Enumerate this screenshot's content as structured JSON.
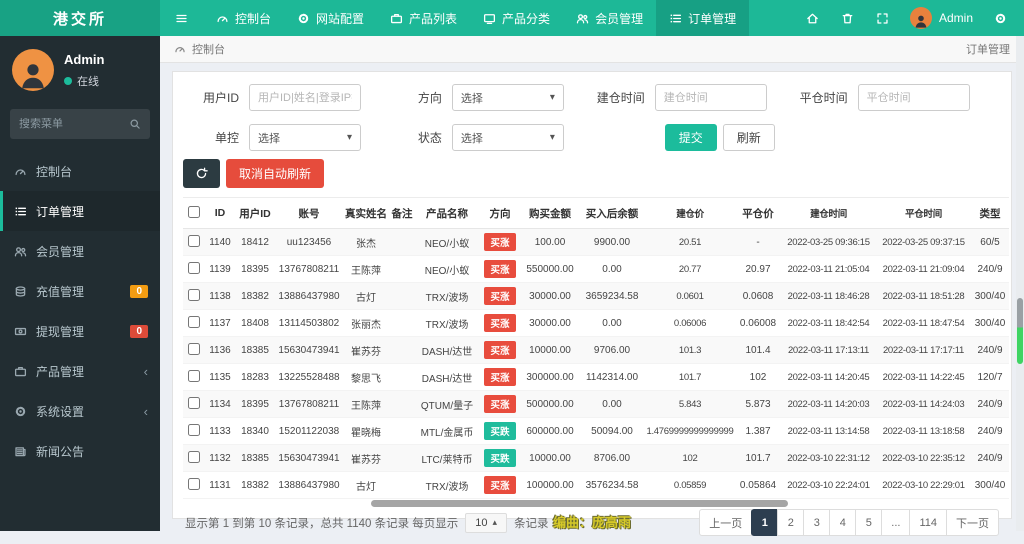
{
  "navbar": {
    "brand": "港交所",
    "items": [
      {
        "label": "控制台",
        "icon": "dashboard-icon"
      },
      {
        "label": "网站配置",
        "icon": "gear-icon"
      },
      {
        "label": "产品列表",
        "icon": "briefcase-icon"
      },
      {
        "label": "产品分类",
        "icon": "tv-icon"
      },
      {
        "label": "会员管理",
        "icon": "users-icon"
      },
      {
        "label": "订单管理",
        "icon": "list-icon",
        "active": true
      }
    ],
    "user_name": "Admin"
  },
  "sidebar": {
    "user_name": "Admin",
    "user_status": "在线",
    "search_placeholder": "搜索菜单",
    "items": [
      {
        "label": "控制台"
      },
      {
        "label": "订单管理",
        "active": true
      },
      {
        "label": "会员管理"
      },
      {
        "label": "充值管理",
        "badge": "0"
      },
      {
        "label": "提现管理",
        "badge": "0"
      },
      {
        "label": "产品管理",
        "chevron": "‹"
      },
      {
        "label": "系统设置",
        "chevron": "‹"
      },
      {
        "label": "新闻公告"
      }
    ]
  },
  "breadcrumb": {
    "current": "控制台",
    "page": "订单管理"
  },
  "filters": {
    "user_id_label": "用户ID",
    "user_id_placeholder": "用户ID|姓名|登录IP搜索",
    "direction_label": "方向",
    "direction_value": "选择",
    "open_time_label": "建仓时间",
    "open_time_placeholder": "建仓时间",
    "close_time_label": "平仓时间",
    "close_time_placeholder": "平仓时间",
    "control_label": "单控",
    "control_value": "选择",
    "status_label": "状态",
    "status_value": "选择",
    "submit_label": "提交",
    "refresh_label": "刷新"
  },
  "toolbar": {
    "cancel_auto_refresh": "取消自动刷新"
  },
  "table": {
    "columns": [
      "ID",
      "用户ID",
      "账号",
      "真实姓名",
      "备注",
      "产品名称",
      "方向",
      "购买金额",
      "买入后余额",
      "建仓价",
      "平仓价",
      "建仓时间",
      "平仓时间",
      "类型"
    ],
    "rows": [
      {
        "id": "1140",
        "uid": "18412",
        "account": "uu123456",
        "name": "张杰",
        "note": "",
        "product": "NEO/小蚁",
        "dir": "买涨",
        "dir_type": "up",
        "amount": "100.00",
        "balance": "9900.00",
        "open_price": "20.51",
        "close_price": "-",
        "open_time": "2022-03-25 09:36:15",
        "close_time": "2022-03-25 09:37:15",
        "type": "60/5"
      },
      {
        "id": "1139",
        "uid": "18395",
        "account": "13767808211",
        "name": "王陈萍",
        "note": "",
        "product": "NEO/小蚁",
        "dir": "买涨",
        "dir_type": "up",
        "amount": "550000.00",
        "balance": "0.00",
        "open_price": "20.77",
        "close_price": "20.97",
        "open_time": "2022-03-11 21:05:04",
        "close_time": "2022-03-11 21:09:04",
        "type": "240/9"
      },
      {
        "id": "1138",
        "uid": "18382",
        "account": "13886437980",
        "name": "古灯",
        "note": "",
        "product": "TRX/波场",
        "dir": "买涨",
        "dir_type": "up",
        "amount": "30000.00",
        "balance": "3659234.58",
        "open_price": "0.0601",
        "close_price": "0.0608",
        "open_time": "2022-03-11 18:46:28",
        "close_time": "2022-03-11 18:51:28",
        "type": "300/40"
      },
      {
        "id": "1137",
        "uid": "18408",
        "account": "13114503802",
        "name": "张丽杰",
        "note": "",
        "product": "TRX/波场",
        "dir": "买涨",
        "dir_type": "up",
        "amount": "30000.00",
        "balance": "0.00",
        "open_price": "0.06006",
        "close_price": "0.06008",
        "open_time": "2022-03-11 18:42:54",
        "close_time": "2022-03-11 18:47:54",
        "type": "300/40"
      },
      {
        "id": "1136",
        "uid": "18385",
        "account": "15630473941",
        "name": "崔苏芬",
        "note": "",
        "product": "DASH/达世",
        "dir": "买涨",
        "dir_type": "up",
        "amount": "10000.00",
        "balance": "9706.00",
        "open_price": "101.3",
        "close_price": "101.4",
        "open_time": "2022-03-11 17:13:11",
        "close_time": "2022-03-11 17:17:11",
        "type": "240/9"
      },
      {
        "id": "1135",
        "uid": "18283",
        "account": "13225528488",
        "name": "黎思飞",
        "note": "",
        "product": "DASH/达世",
        "dir": "买涨",
        "dir_type": "up",
        "amount": "300000.00",
        "balance": "1142314.00",
        "open_price": "101.7",
        "close_price": "102",
        "open_time": "2022-03-11 14:20:45",
        "close_time": "2022-03-11 14:22:45",
        "type": "120/7"
      },
      {
        "id": "1134",
        "uid": "18395",
        "account": "13767808211",
        "name": "王陈萍",
        "note": "",
        "product": "QTUM/量子",
        "dir": "买涨",
        "dir_type": "up",
        "amount": "500000.00",
        "balance": "0.00",
        "open_price": "5.843",
        "close_price": "5.873",
        "open_time": "2022-03-11 14:20:03",
        "close_time": "2022-03-11 14:24:03",
        "type": "240/9"
      },
      {
        "id": "1133",
        "uid": "18340",
        "account": "15201122038",
        "name": "瞿晓梅",
        "note": "",
        "product": "MTL/金属币",
        "dir": "买跌",
        "dir_type": "down",
        "amount": "600000.00",
        "balance": "50094.00",
        "open_price": "1.4769999999999999",
        "close_price": "1.387",
        "open_time": "2022-03-11 13:14:58",
        "close_time": "2022-03-11 13:18:58",
        "type": "240/9"
      },
      {
        "id": "1132",
        "uid": "18385",
        "account": "15630473941",
        "name": "崔苏芬",
        "note": "",
        "product": "LTC/莱特币",
        "dir": "买跌",
        "dir_type": "down",
        "amount": "10000.00",
        "balance": "8706.00",
        "open_price": "102",
        "close_price": "101.7",
        "open_time": "2022-03-10 22:31:12",
        "close_time": "2022-03-10 22:35:12",
        "type": "240/9"
      },
      {
        "id": "1131",
        "uid": "18382",
        "account": "13886437980",
        "name": "古灯",
        "note": "",
        "product": "TRX/波场",
        "dir": "买涨",
        "dir_type": "up",
        "amount": "100000.00",
        "balance": "3576234.58",
        "open_price": "0.05859",
        "close_price": "0.05864",
        "open_time": "2022-03-10 22:24:01",
        "close_time": "2022-03-10 22:29:01",
        "type": "300/40"
      }
    ]
  },
  "pagination": {
    "summary_prefix": "显示第 1 到第 10 条记录，总共 1140 条记录 每页显示",
    "page_size": "10",
    "summary_suffix": "条记录",
    "prev_label": "上一页",
    "next_label": "下一页",
    "pages": [
      {
        "label": "1",
        "active": true
      },
      {
        "label": "2"
      },
      {
        "label": "3"
      },
      {
        "label": "4"
      },
      {
        "label": "5"
      },
      {
        "label": "..."
      },
      {
        "label": "114"
      }
    ]
  },
  "watermark": "编曲：庞高雨",
  "colors": {
    "navbar_green": "#1db897",
    "brand_green": "#18a284",
    "sidebar_bg": "#222d32",
    "accent": "#1cbc9c",
    "badge_up_red": "#e84c3d",
    "badge_down_green": "#1fbc9c",
    "recharge_badge_orange": "#f39c12",
    "withdraw_badge_red": "#dd4b39",
    "cancel_button_red": "#e64c3c",
    "refresh_button_dark": "#2c3b41",
    "pagination_active": "#2d3e50"
  }
}
